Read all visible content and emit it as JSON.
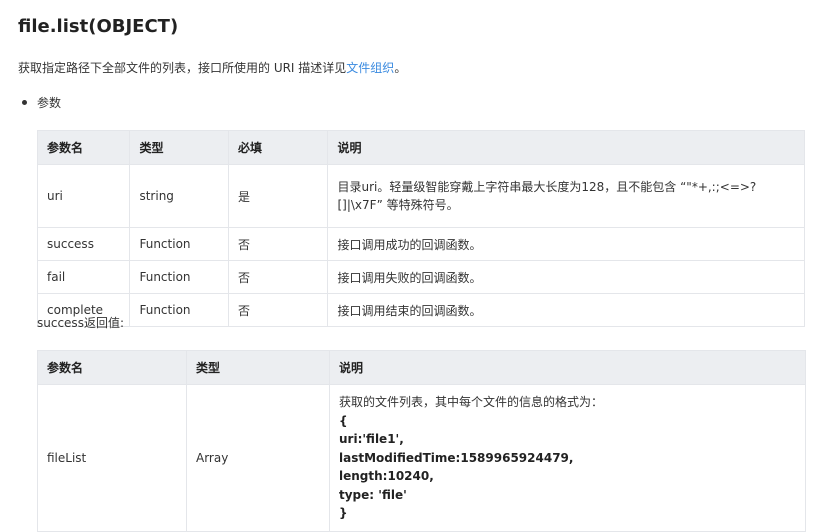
{
  "title": "file.list(OBJECT)",
  "intro": {
    "text": "获取指定路径下全部文件的列表，接口所使用的 URI 描述详见",
    "link": "文件组织",
    "suffix": "。"
  },
  "bullet": "参数",
  "params_table": {
    "headers": [
      "参数名",
      "类型",
      "必填",
      "说明"
    ],
    "rows": [
      {
        "name": "uri",
        "type": "string",
        "required": "是",
        "desc_line1": "目录uri。轻量级智能穿戴上字符串最大长度为128，且不能包含 “\"*+,:;<=>?",
        "desc_line2": "[]|\\x7F” 等特殊符号。"
      },
      {
        "name": "success",
        "type": "Function",
        "required": "否",
        "desc": "接口调用成功的回调函数。"
      },
      {
        "name": "fail",
        "type": "Function",
        "required": "否",
        "desc": "接口调用失败的回调函数。"
      },
      {
        "name": "complete",
        "type": "Function",
        "required": "否",
        "desc": "接口调用结束的回调函数。"
      }
    ]
  },
  "success_label": "success返回值:",
  "return_table": {
    "headers": [
      "参数名",
      "类型",
      "说明"
    ],
    "rows": [
      {
        "name": "fileList",
        "type": "Array",
        "desc_intro": "获取的文件列表，其中每个文件的信息的格式为：",
        "desc_code": [
          "{",
          "uri:'file1',",
          "lastModifiedTime:1589965924479,",
          "length:10240,",
          "type: 'file'",
          "}"
        ]
      }
    ]
  }
}
